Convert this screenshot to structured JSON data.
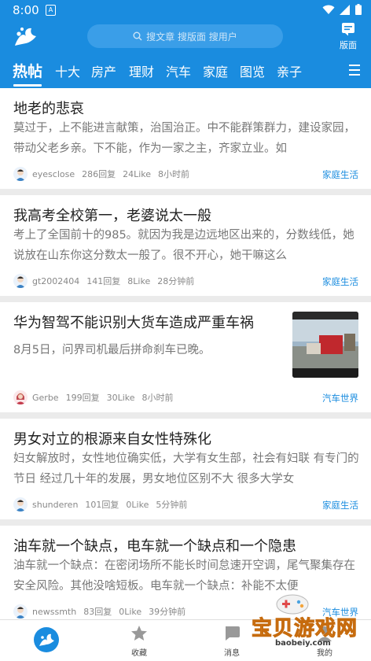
{
  "status": {
    "time": "8:00",
    "notif_glyph": "A"
  },
  "header": {
    "search_placeholder": "搜文章 搜版面 搜用户",
    "edition_label": "版面"
  },
  "tabs": [
    {
      "label": "热帖"
    },
    {
      "label": "十大"
    },
    {
      "label": "房产"
    },
    {
      "label": "理财"
    },
    {
      "label": "汽车"
    },
    {
      "label": "家庭"
    },
    {
      "label": "图览"
    },
    {
      "label": "亲子"
    }
  ],
  "posts": [
    {
      "title": "地老的悲哀",
      "snippet": "莫过于，上不能进言献策，治国治正。中不能群策群力，建设家园，带动父老乡亲。下不能，作为一家之主，齐家立业。如",
      "user": "eyesclose",
      "replies": "286回复",
      "likes": "24Like",
      "time": "8小时前",
      "category": "家庭生活"
    },
    {
      "title": "我高考全校第一，老婆说太一般",
      "snippet": "考上了全国前十的985。就因为我是边远地区出来的，分数线低，她说放在山东你这分数太一般了。很不开心，她干嘛这么",
      "user": "gt2002404",
      "replies": "141回复",
      "likes": "8Like",
      "time": "28分钟前",
      "category": "家庭生活"
    },
    {
      "title": "华为智驾不能识别大货车造成严重车祸",
      "snippet": "8月5日，问界司机最后拼命刹车已晚。",
      "user": "Gerbe",
      "replies": "199回复",
      "likes": "30Like",
      "time": "8小时前",
      "category": "汽车世界"
    },
    {
      "title": "男女对立的根源来自女性特殊化",
      "snippet": "妇女解放时，女性地位确实低，大学有女生部，社会有妇联 有专门的节日 经过几十年的发展，男女地位区别不大 很多大学女",
      "user": "shunderen",
      "replies": "101回复",
      "likes": "0Like",
      "time": "5分钟前",
      "category": "家庭生活"
    },
    {
      "title": "油车就一个缺点，电车就一个缺点和一个隐患",
      "snippet": "油车就一个缺点：在密闭场所不能长时间怠速开空调，尾气聚集存在安全风险。其他没啥短板。电车就一个缺点：补能不太便",
      "user": "newssmth",
      "replies": "83回复",
      "likes": "0Like",
      "time": "39分钟前",
      "category": "汽车世界"
    }
  ],
  "bottom_nav": [
    {
      "label": ""
    },
    {
      "label": "收藏"
    },
    {
      "label": "消息"
    },
    {
      "label": "我的"
    }
  ],
  "watermark": {
    "text": "宝贝游戏网",
    "url": "baobeiy.com"
  },
  "colors": {
    "brand": "#1a8cdf",
    "category": "#1a8cdf",
    "background": "#ebebeb"
  }
}
